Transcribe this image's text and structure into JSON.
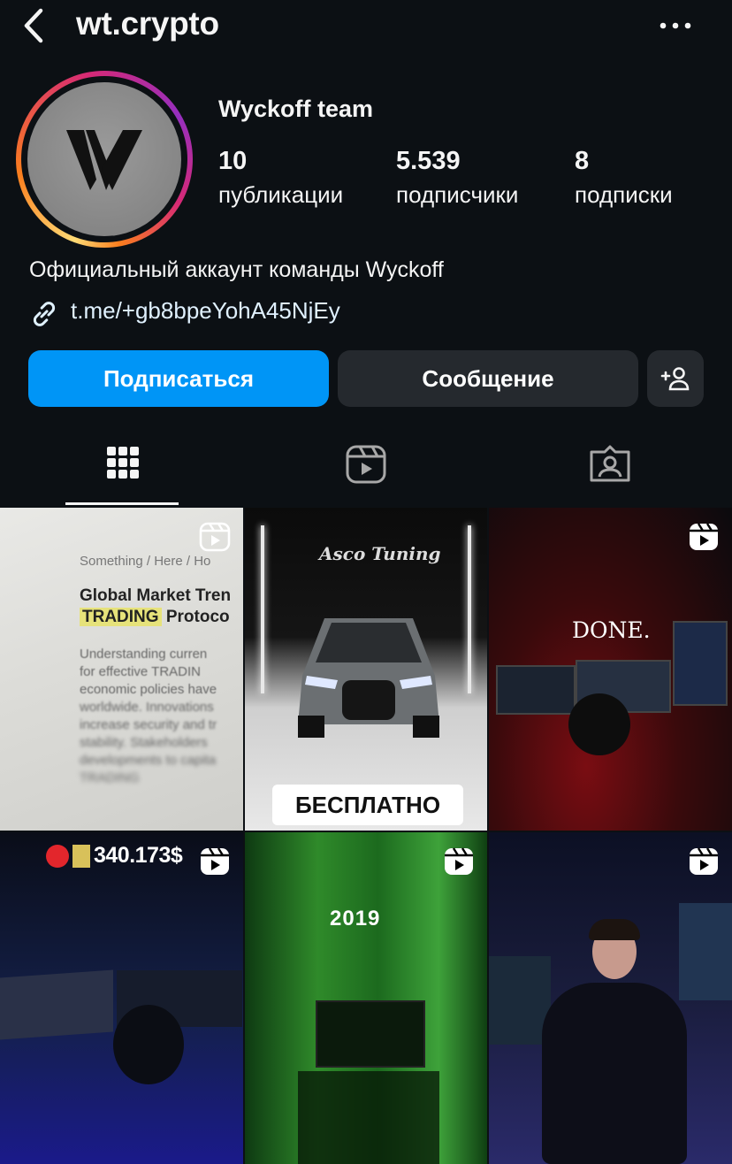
{
  "header": {
    "back_icon": "chevron-left-icon",
    "username": "wt.crypto",
    "more_icon": "more-horizontal-icon"
  },
  "profile": {
    "avatar_letter": "W",
    "full_name": "Wyckoff team",
    "stats": {
      "posts": {
        "value": "10",
        "label": "публикации"
      },
      "followers": {
        "value": "5.539",
        "label": "подписчики"
      },
      "following": {
        "value": "8",
        "label": "подписки"
      }
    },
    "bio": "Официальный аккаунт команды Wyckoff",
    "link": "t.me/+gb8bpeYohA45NjEy"
  },
  "actions": {
    "follow_label": "Подписаться",
    "message_label": "Сообщение",
    "add_user_icon": "add-person-icon"
  },
  "tabs": [
    {
      "name": "grid",
      "icon": "grid-icon",
      "active": true
    },
    {
      "name": "reels",
      "icon": "reels-icon",
      "active": false
    },
    {
      "name": "tagged",
      "icon": "tagged-person-icon",
      "active": false
    }
  ],
  "posts": [
    {
      "type": "reel",
      "lines": [
        "Something / Here / Ho",
        "Global Market Tren",
        "TRADING",
        " Protoco",
        "Understanding curren",
        "for effective TRADIN",
        "economic policies have",
        "worldwide. Innovations",
        "increase security and tr",
        "stability. Stakeholders",
        "developments to capita",
        "TRADING"
      ]
    },
    {
      "type": "reel",
      "title": "Asco Tuning",
      "caption": "БЕСПЛАТНО"
    },
    {
      "type": "reel",
      "title": "DONE."
    },
    {
      "type": "reel",
      "caption": "340.173$"
    },
    {
      "type": "reel",
      "title": "2019"
    },
    {
      "type": "reel"
    }
  ],
  "colors": {
    "background": "#0c1014",
    "accent": "#0095f6",
    "secondary_button": "#25292e",
    "link": "#e0f1ff"
  }
}
